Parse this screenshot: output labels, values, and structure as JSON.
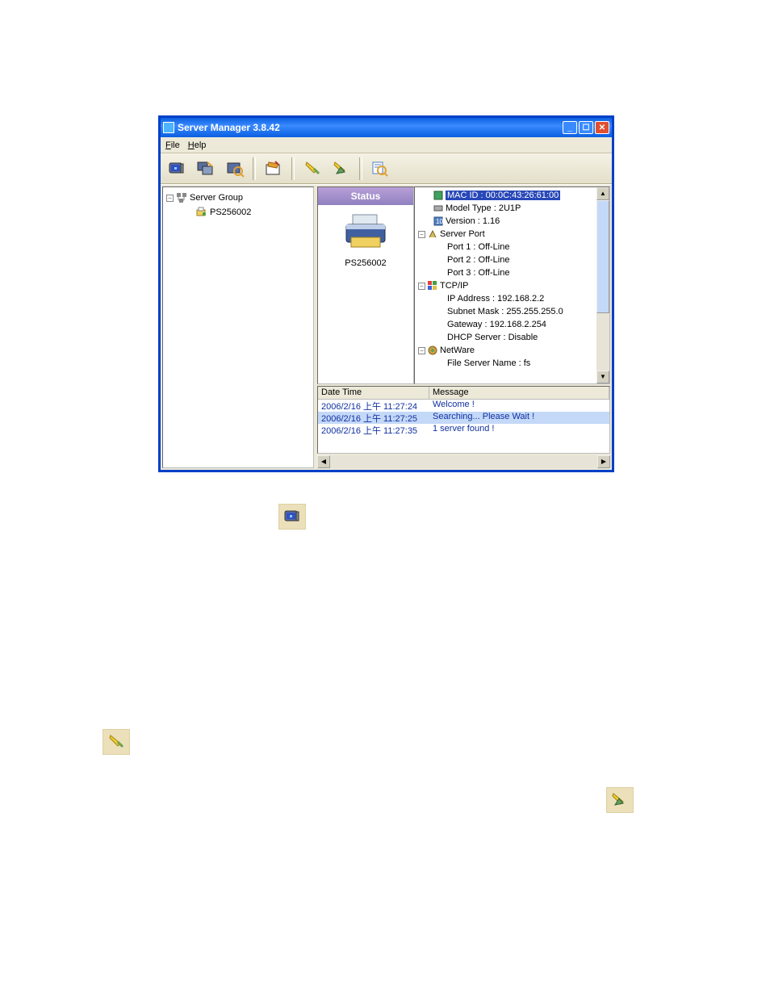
{
  "window": {
    "title": "Server Manager 3.8.42",
    "menu": {
      "file": "File",
      "help": "Help"
    }
  },
  "tree": {
    "root": "Server Group",
    "child": "PS256002"
  },
  "status": {
    "header": "Status",
    "printer_name": "PS256002"
  },
  "details": {
    "mac_id": "MAC ID : 00:0C:43:26:61:00",
    "model_type": "Model Type : 2U1P",
    "version": "Version : 1.16",
    "server_port": "Server Port",
    "port1": "Port 1 : Off-Line",
    "port2": "Port 2 : Off-Line",
    "port3": "Port 3 : Off-Line",
    "tcpip": "TCP/IP",
    "ip": "IP Address : 192.168.2.2",
    "subnet": "Subnet Mask : 255.255.255.0",
    "gateway": "Gateway : 192.168.2.254",
    "dhcp": "DHCP Server : Disable",
    "netware": "NetWare",
    "fileserver": "File Server Name : fs"
  },
  "log": {
    "col1": "Date Time",
    "col2": "Message",
    "rows": [
      {
        "dt": "2006/2/16 上午 11:27:24",
        "msg": "Welcome !"
      },
      {
        "dt": "2006/2/16 上午 11:27:25",
        "msg": "Searching... Please Wait !"
      },
      {
        "dt": "2006/2/16 上午 11:27:35",
        "msg": "1 server found !"
      }
    ]
  }
}
